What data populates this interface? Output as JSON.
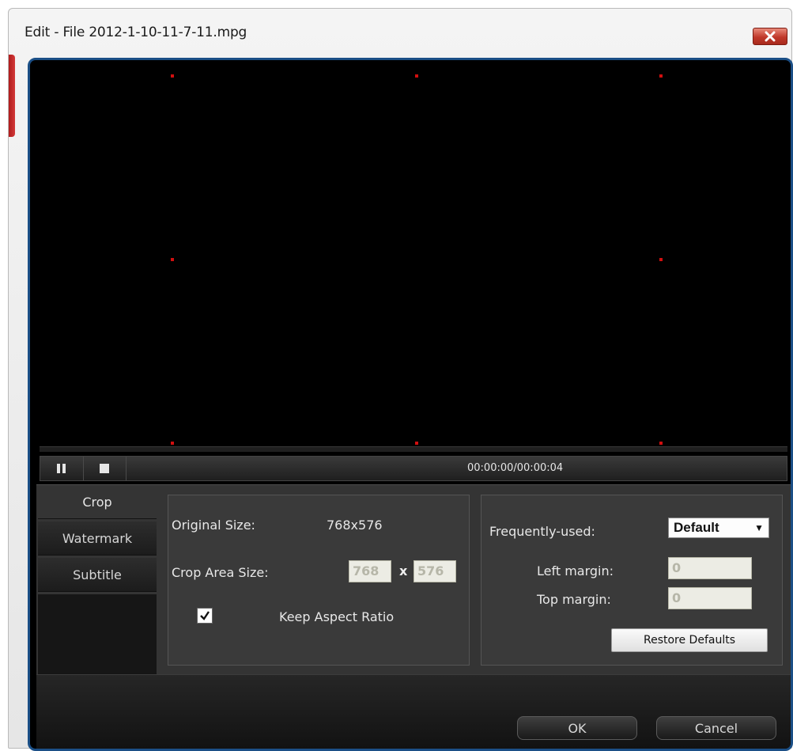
{
  "window": {
    "title": "Edit - File 2012-1-10-11-7-11.mpg"
  },
  "player": {
    "time": "00:00:00/00:00:04",
    "pause_icon": "pause-icon",
    "stop_icon": "stop-icon",
    "handle_color": "#d10f0f"
  },
  "tabs": [
    {
      "label": "Crop",
      "active": true
    },
    {
      "label": "Watermark",
      "active": false
    },
    {
      "label": "Subtitle",
      "active": false
    }
  ],
  "crop": {
    "original_size_label": "Original Size:",
    "original_size_value": "768x576",
    "crop_area_label": "Crop Area Size:",
    "width_value": "768",
    "x_separator": "x",
    "height_value": "576",
    "keep_aspect_label": "Keep Aspect Ratio",
    "keep_aspect_checked": true
  },
  "settings": {
    "frequently_used_label": "Frequently-used:",
    "frequently_used_value": "Default",
    "left_margin_label": "Left margin:",
    "left_margin_value": "0",
    "top_margin_label": "Top margin:",
    "top_margin_value": "0",
    "restore_label": "Restore Defaults"
  },
  "footer": {
    "ok_label": "OK",
    "cancel_label": "Cancel"
  },
  "colors": {
    "frame_border": "#1b4f86",
    "close_button": "#c0392b"
  }
}
